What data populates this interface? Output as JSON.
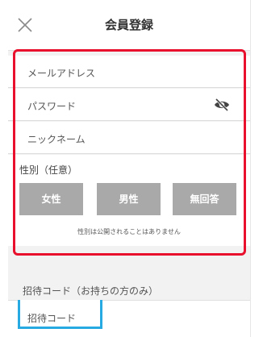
{
  "header": {
    "title": "会員登録",
    "close_icon": "close-icon"
  },
  "form": {
    "email_placeholder": "メールアドレス",
    "password_placeholder": "パスワード",
    "password_icon": "eye-slash-icon",
    "nickname_placeholder": "ニックネーム"
  },
  "gender": {
    "label": "性別（任意）",
    "options": [
      "女性",
      "男性",
      "無回答"
    ],
    "note": "性別は公開されることはありません"
  },
  "invite": {
    "label": "招待コード（お持ちの方のみ）",
    "placeholder": "招待コード"
  },
  "colors": {
    "highlight_red": "#e8102c",
    "highlight_cyan": "#27a9e1",
    "gender_button": "#a9a9a9"
  }
}
